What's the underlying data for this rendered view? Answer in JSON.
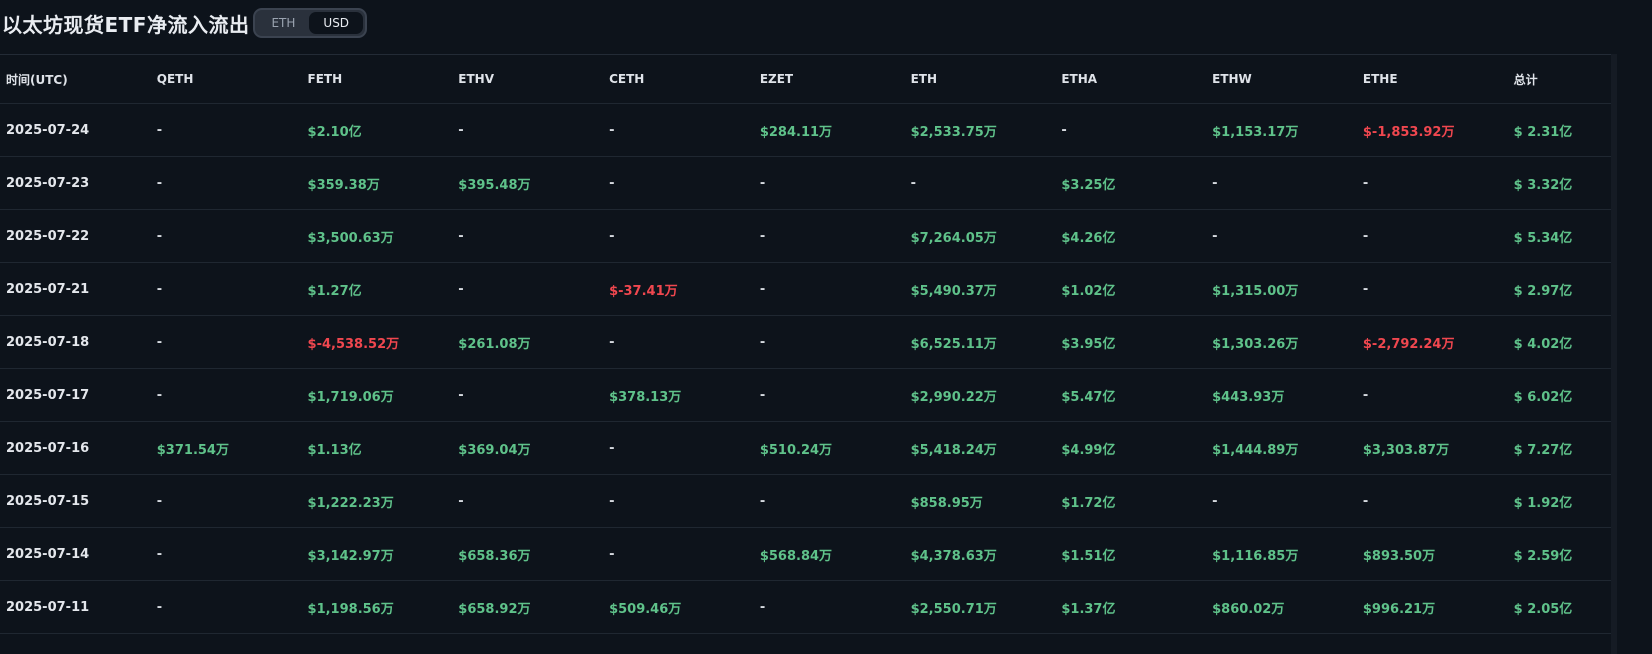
{
  "header": {
    "title": "以太坊现货ETF净流入流出",
    "toggle": {
      "options": [
        "ETH",
        "USD"
      ],
      "selected": "USD"
    }
  },
  "colors": {
    "positive": "#5fc28a",
    "negative": "#f0474f",
    "background": "#0d131b"
  },
  "table": {
    "columns": [
      "时间(UTC)",
      "QETH",
      "FETH",
      "ETHV",
      "CETH",
      "EZET",
      "ETH",
      "ETHA",
      "ETHW",
      "ETHE",
      "总计"
    ],
    "rows": [
      [
        "2025-07-24",
        "-",
        "$2.10亿",
        "-",
        "-",
        "$284.11万",
        "$2,533.75万",
        "-",
        "$1,153.17万",
        "$-1,853.92万",
        "$ 2.31亿"
      ],
      [
        "2025-07-23",
        "-",
        "$359.38万",
        "$395.48万",
        "-",
        "-",
        "-",
        "$3.25亿",
        "-",
        "-",
        "$ 3.32亿"
      ],
      [
        "2025-07-22",
        "-",
        "$3,500.63万",
        "-",
        "-",
        "-",
        "$7,264.05万",
        "$4.26亿",
        "-",
        "-",
        "$ 5.34亿"
      ],
      [
        "2025-07-21",
        "-",
        "$1.27亿",
        "-",
        "$-37.41万",
        "-",
        "$5,490.37万",
        "$1.02亿",
        "$1,315.00万",
        "-",
        "$ 2.97亿"
      ],
      [
        "2025-07-18",
        "-",
        "$-4,538.52万",
        "$261.08万",
        "-",
        "-",
        "$6,525.11万",
        "$3.95亿",
        "$1,303.26万",
        "$-2,792.24万",
        "$ 4.02亿"
      ],
      [
        "2025-07-17",
        "-",
        "$1,719.06万",
        "-",
        "$378.13万",
        "-",
        "$2,990.22万",
        "$5.47亿",
        "$443.93万",
        "-",
        "$ 6.02亿"
      ],
      [
        "2025-07-16",
        "$371.54万",
        "$1.13亿",
        "$369.04万",
        "-",
        "$510.24万",
        "$5,418.24万",
        "$4.99亿",
        "$1,444.89万",
        "$3,303.87万",
        "$ 7.27亿"
      ],
      [
        "2025-07-15",
        "-",
        "$1,222.23万",
        "-",
        "-",
        "-",
        "$858.95万",
        "$1.72亿",
        "-",
        "-",
        "$ 1.92亿"
      ],
      [
        "2025-07-14",
        "-",
        "$3,142.97万",
        "$658.36万",
        "-",
        "$568.84万",
        "$4,378.63万",
        "$1.51亿",
        "$1,116.85万",
        "$893.50万",
        "$ 2.59亿"
      ],
      [
        "2025-07-11",
        "-",
        "$1,198.56万",
        "$658.92万",
        "$509.46万",
        "-",
        "$2,550.71万",
        "$1.37亿",
        "$860.02万",
        "$996.21万",
        "$ 2.05亿"
      ]
    ]
  }
}
